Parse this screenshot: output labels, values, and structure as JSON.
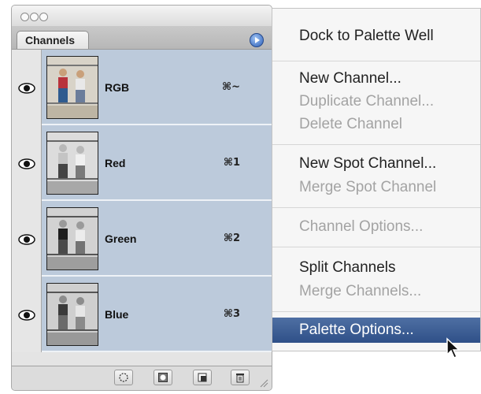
{
  "palette": {
    "tab_label": "Channels",
    "channels": [
      {
        "name": "RGB",
        "shortcut": "⌘~"
      },
      {
        "name": "Red",
        "shortcut": "⌘1"
      },
      {
        "name": "Green",
        "shortcut": "⌘2"
      },
      {
        "name": "Blue",
        "shortcut": "⌘3"
      }
    ],
    "bottom_tools": [
      "load-selection-icon",
      "save-selection-icon",
      "new-channel-icon",
      "trash-icon"
    ]
  },
  "menu": {
    "items": [
      {
        "label": "Dock to Palette Well",
        "enabled": true
      },
      {
        "label": "New Channel...",
        "enabled": true
      },
      {
        "label": "Duplicate Channel...",
        "enabled": false
      },
      {
        "label": "Delete Channel",
        "enabled": false
      },
      {
        "label": "New Spot Channel...",
        "enabled": true
      },
      {
        "label": "Merge Spot Channel",
        "enabled": false
      },
      {
        "label": "Channel Options...",
        "enabled": false
      },
      {
        "label": "Split Channels",
        "enabled": true
      },
      {
        "label": "Merge Channels...",
        "enabled": false
      },
      {
        "label": "Palette Options...",
        "enabled": true,
        "highlighted": true
      }
    ]
  },
  "colors": {
    "selected_row": "#bccadb",
    "menu_highlight": "#3a5b92"
  }
}
